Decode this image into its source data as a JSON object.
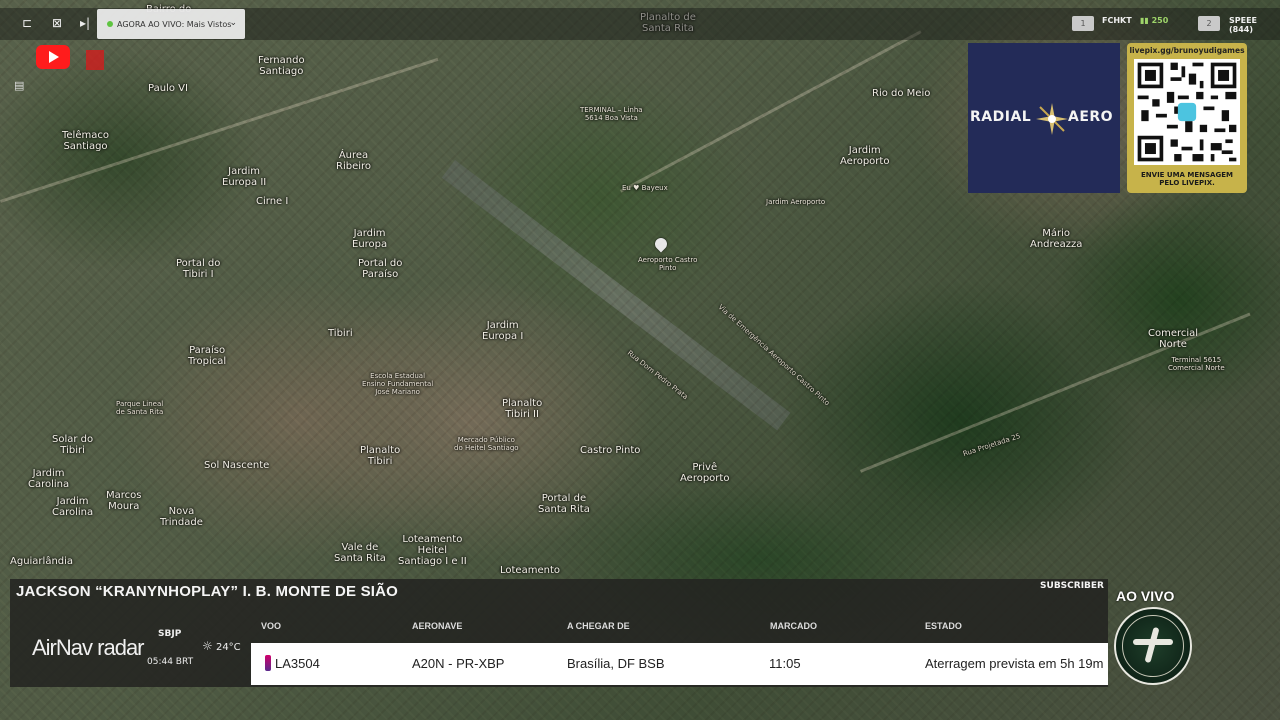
{
  "topbar": {
    "live_label": "AGORA AO VIVO: Mais Vistos",
    "badge1": "1",
    "stat1_label": "FCHKT",
    "stat1_value": "250",
    "badge2": "2",
    "stat2_label": "SPEEE (844)"
  },
  "map": {
    "labels": [
      "Bairro do",
      "Fernando\nSantiago",
      "Paulo VI",
      "Telêmaco\nSantiago",
      "Áurea\nRibeiro",
      "Jardim\nEuropa II",
      "Cirne I",
      "Jardim\nEuropa",
      "Portal do\nTibiri I",
      "Portal do\nParaíso",
      "Tibiri",
      "Paraíso\nTropical",
      "Jardim\nEuropa I",
      "Escola Estadual\nEnsino Fundamental\nJosé Mariano",
      "Planalto\nTibiri II",
      "Mercado Público\ndo Heitel Santiago",
      "Planalto\nTibiri",
      "Sol Nascente",
      "Solar do\nTibiri",
      "Jardim\nCarolina",
      "Jardim\nCarolina",
      "Marcos\nMoura",
      "Nova\nTrindade",
      "Vale de\nSanta Rita",
      "Loteamento\nHeitel\nSantiago I e II",
      "Castro Pinto",
      "Portal de\nSanta Rita",
      "Privê\nAeroporto",
      "Loteamento",
      "Aguiarlândia",
      "Planalto de\nSanta Rita",
      "TERMINAL – Linha\n5614 Boa Vista",
      "Eu ♥ Bayeux",
      "Jardim\nAeroporto",
      "Jardim Aeroporto",
      "Rio do Meio",
      "Mário\nAndreazza",
      "Comercial\nNorte",
      "Terminal 5615\nComercial Norte",
      "Aeroporto Castro\nPinto",
      "Parque Lineal\nde Santa Rita",
      "Rua Projetada 25",
      "Via de Emergência Aeroporto Castro Pinto",
      "Rua Dom Pedro Prata"
    ]
  },
  "sponsor": {
    "word_left": "RADIAL",
    "word_right": "AERO"
  },
  "qr": {
    "url": "livepix.gg/brunoyudigames",
    "text": "ENVIE UMA MENSAGEM\nPELO LIVEPIX."
  },
  "ticker": {
    "streamer": "JACKSON “KRANYNHOPLAY” I. B. MONTE DE SIÃO",
    "subscriber_label": "SUBSCRIBER",
    "brand_main": "AirNav",
    "brand_sub": "radar",
    "airport": "SBJP",
    "time": "05:44 BRT",
    "temp": "24°C",
    "headers": {
      "flight": "VOO",
      "aircraft": "AERONAVE",
      "from": "A CHEGAR DE",
      "scheduled": "MARCADO",
      "status": "ESTADO"
    },
    "row": {
      "flight": "LA3504",
      "aircraft": "A20N - PR-XBP",
      "from": "Brasília, DF BSB",
      "scheduled": "11:05",
      "status": "Aterragem prevista em 5h 19m"
    }
  },
  "live_badge": {
    "label": "AO VIVO"
  }
}
